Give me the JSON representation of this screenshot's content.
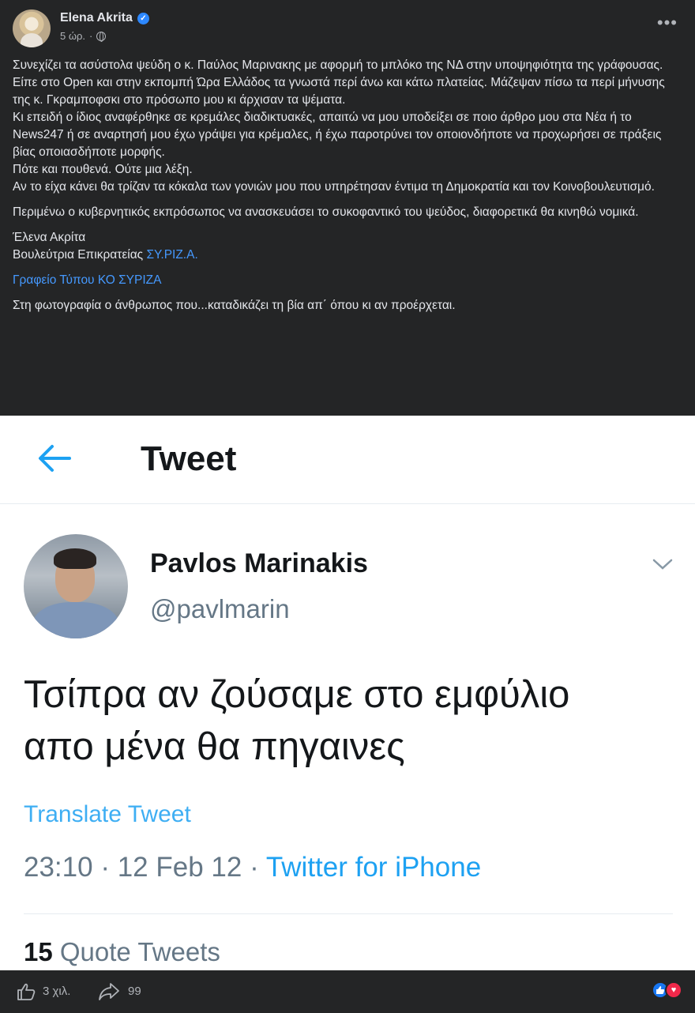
{
  "post": {
    "author": "Elena Akrita",
    "time": "5 ώρ.",
    "separator": "·",
    "more": "•••",
    "paragraphs": [
      "Συνεχίζει τα ασύστολα ψεύδη ο κ. Παύλος Μαρινακης με αφορμή το μπλόκο της ΝΔ στην υποψηφιότητα της γράφουσας. Είπε στο Open και στην εκπομπή Ώρα Ελλάδος τα γνωστά περί άνω και κάτω πλατείας. Μάζεψαν πίσω τα περί μήνυσης της κ. Γκραμποφσκι στο πρόσωπο μου κι άρχισαν τα ψέματα.",
      "Κι επειδή ο ίδιος αναφέρθηκε σε κρεμάλες διαδικτυακές, απαιτώ να μου υποδείξει σε ποιο άρθρο μου στα Νέα ή το News247 ή σε αναρτησή μου έχω γράψει για κρέμαλες, ή έχω παροτρύνει τον οποιονδήποτε να προχωρήσει σε πράξεις βίας οποιασδήποτε μορφής.",
      "Πότε και πουθενά. Ούτε μια λέξη.",
      "Αν το είχα κάνει θα τρίζαν τα κόκαλα των γονιών μου που υπηρέτησαν έντιμα τη Δημοκρατία και τον Κοινοβουλευτισμό.",
      "Περιμένω ο κυβερνητικός εκπρόσωπος να ανασκευάσει το συκοφαντικό του ψεύδος, διαφορετικά θα κινηθώ νομικά.",
      "Έλενα Ακρίτα",
      "Βουλεύτρια Επικρατείας",
      "ΣΥ.ΡΙΖ.Α.",
      "Γραφείο Τύπου ΚΟ ΣΥΡΙΖΑ",
      "Στη φωτογραφία ο άνθρωπος που...καταδικάζει τη βία απ΄ όπου κι αν προέρχεται."
    ]
  },
  "tweet": {
    "header_title": "Tweet",
    "name": "Pavlos Marinakis",
    "handle": "@pavlmarin",
    "text_line1": "Τσίπρα αν ζούσαμε στο εμφύλιο",
    "text_line2": "απο μένα θα πηγαινες",
    "translate": "Translate Tweet",
    "time": "23:10",
    "date": "12 Feb 12",
    "sep": "·",
    "client": "Twitter for iPhone",
    "quote_count": "15",
    "quote_label": "Quote Tweets"
  },
  "footer": {
    "likes": "3 χιλ.",
    "shares": "99"
  },
  "colors": {
    "background": "#242526",
    "link": "#4599ff",
    "twitter_blue": "#1da1f2"
  }
}
